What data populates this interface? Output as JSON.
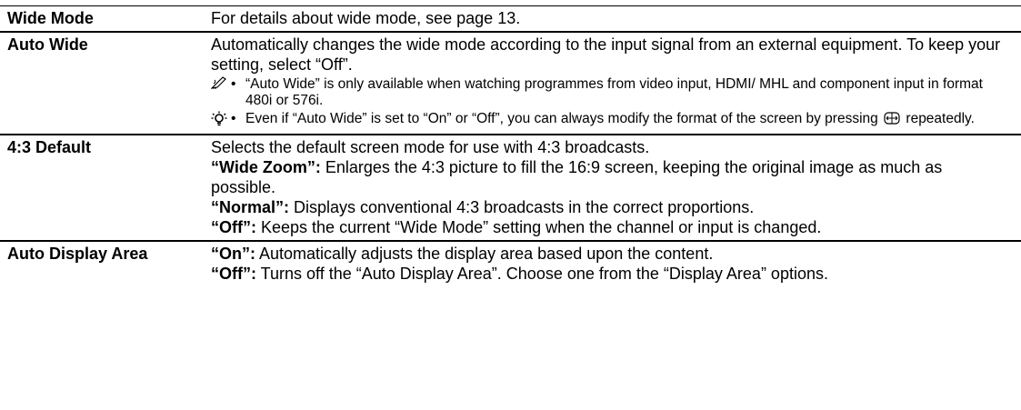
{
  "rows": [
    {
      "label": "Wide Mode",
      "description": "For details about wide mode, see page 13."
    },
    {
      "label": "Auto Wide",
      "description": "Automatically changes the wide mode according to the input signal from an external equipment. To keep your setting, select “Off”.",
      "notes": [
        {
          "icon": "memo-pencil-icon",
          "glyph": "✍",
          "text": "“Auto Wide” is only available when watching programmes from video input, HDMI/ MHL and component input in format 480i or 576i."
        },
        {
          "icon": "lightbulb-tip-icon",
          "glyph": "💡",
          "text_before": "Even if “Auto Wide” is set to “On” or “Off”, you can always modify the format of the screen by pressing",
          "text_after": "repeatedly."
        }
      ]
    },
    {
      "label": "4:3 Default",
      "intro": "Selects the default screen mode for use with 4:3 broadcasts.",
      "options": [
        {
          "name": "“Wide Zoom”:",
          "text": "Enlarges the 4:3 picture to fill the 16:9 screen, keeping the original image as much as possible."
        },
        {
          "name": "“Normal”:",
          "text": "Displays conventional 4:3 broadcasts in the correct proportions."
        },
        {
          "name": "“Off”:",
          "text": "Keeps the current “Wide Mode” setting when the channel or input is changed."
        }
      ]
    },
    {
      "label": "Auto Display Area",
      "options": [
        {
          "name": "“On”:",
          "text": "Automatically adjusts the display area based upon the content."
        },
        {
          "name": "“Off”:",
          "text": "Turns off the “Auto Display Area”. Choose one from the “Display Area” options."
        }
      ]
    }
  ],
  "bullet": "•"
}
